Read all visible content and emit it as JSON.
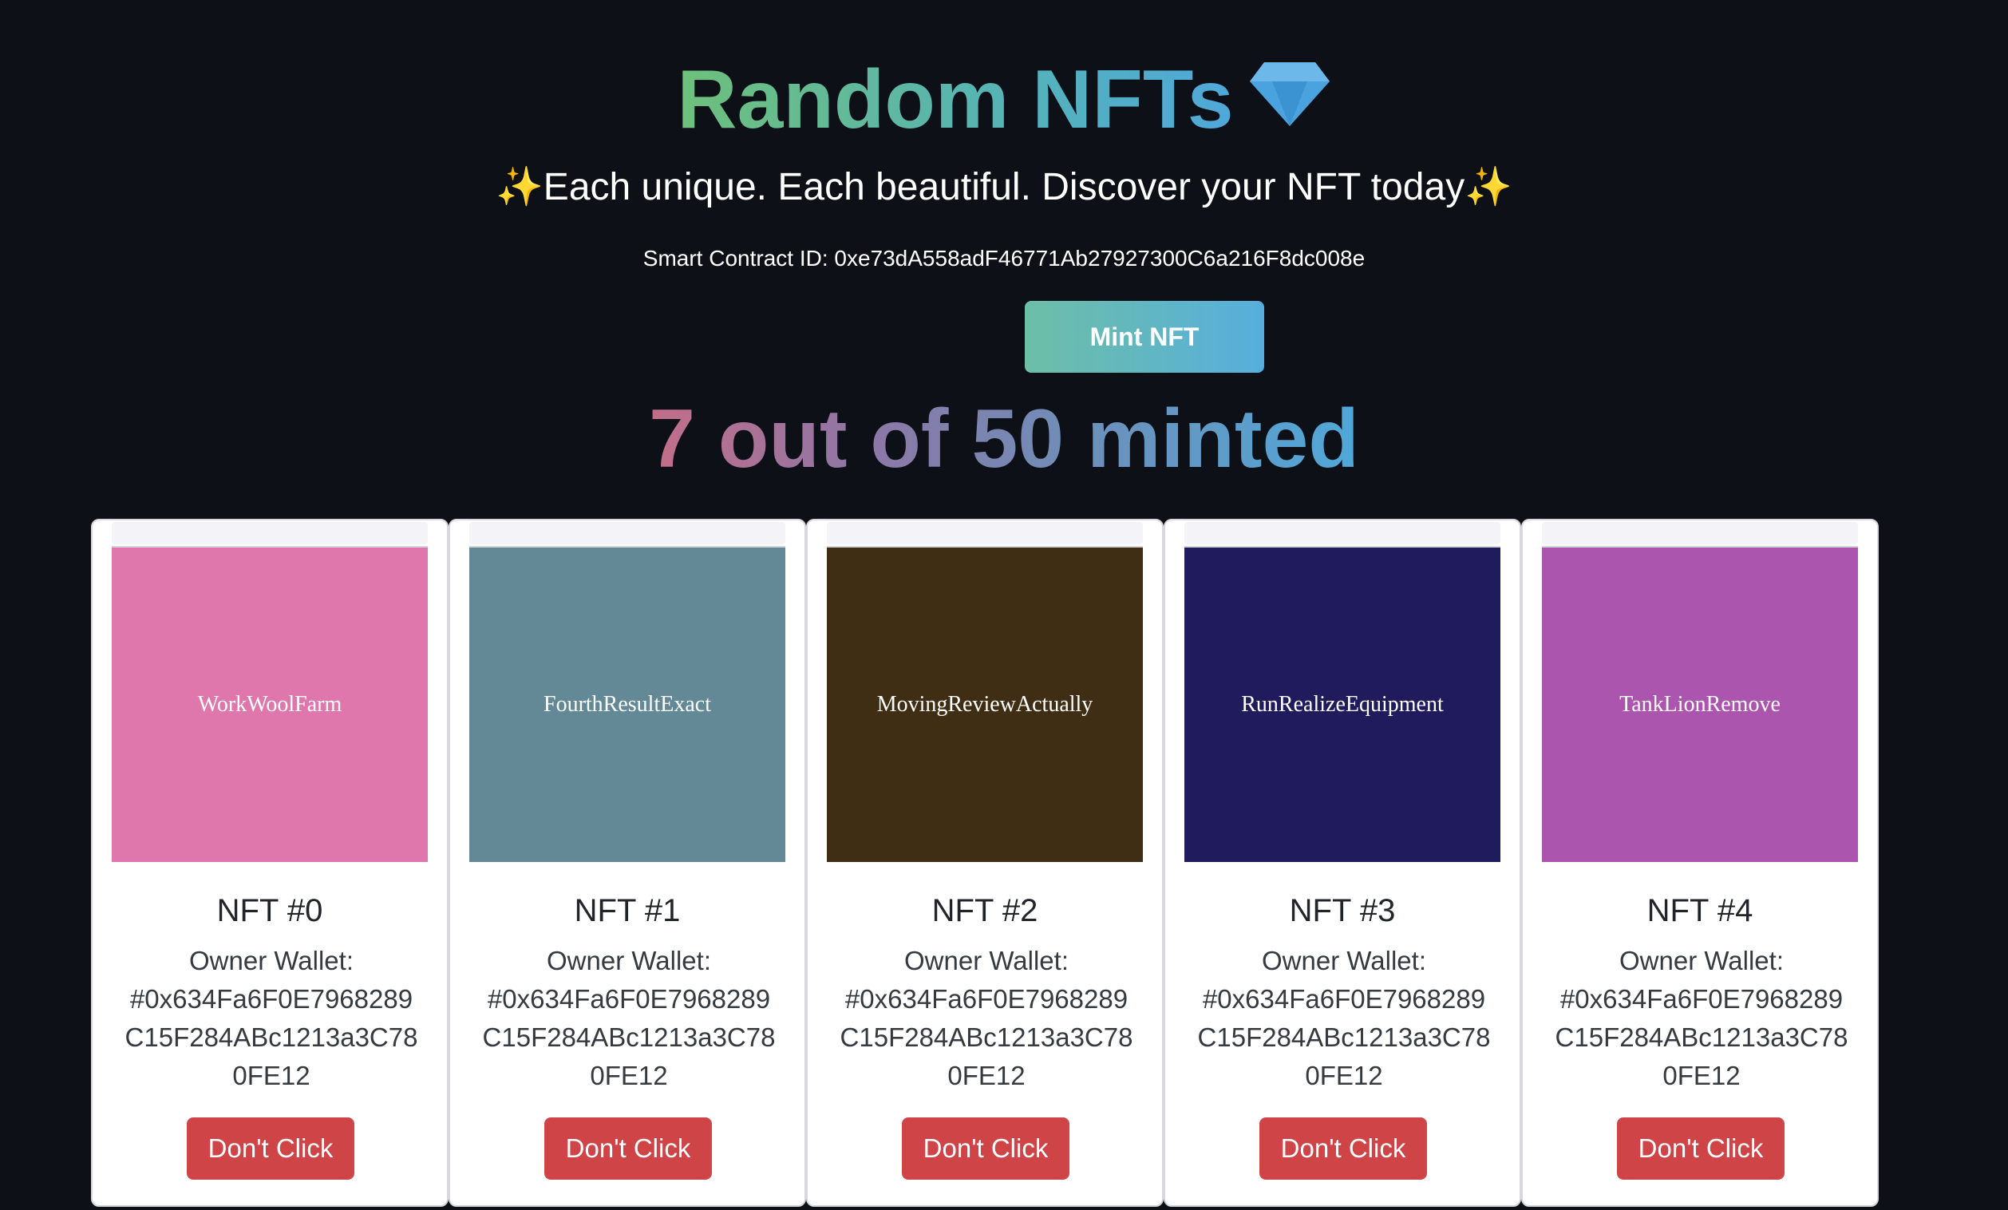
{
  "header": {
    "title": "Random NFTs",
    "title_icon": "gem-icon",
    "subtitle": "Each unique. Each beautiful. Discover your NFT today",
    "subtitle_sparkle": "✨",
    "contract_label": "Smart Contract ID: 0xe73dA558adF46771Ab27927300C6a216F8dc008e",
    "mint_button": "Mint NFT",
    "minted_status": "7 out of 50 minted"
  },
  "colors": {
    "background": "#0d1117",
    "button_danger": "#cf4447"
  },
  "cards": [
    {
      "image_text": "WorkWoolFarm",
      "image_color": "#df77ad",
      "title": "NFT #0",
      "owner_label": "Owner Wallet:",
      "owner_value": "#0x634Fa6F0E7968289C15F284ABc1213a3C780FE12",
      "button": "Don't Click"
    },
    {
      "image_text": "FourthResultExact",
      "image_color": "#638896",
      "title": "NFT #1",
      "owner_label": "Owner Wallet:",
      "owner_value": "#0x634Fa6F0E7968289C15F284ABc1213a3C780FE12",
      "button": "Don't Click"
    },
    {
      "image_text": "MovingReviewActually",
      "image_color": "#3f2e13",
      "title": "NFT #2",
      "owner_label": "Owner Wallet:",
      "owner_value": "#0x634Fa6F0E7968289C15F284ABc1213a3C780FE12",
      "button": "Don't Click"
    },
    {
      "image_text": "RunRealizeEquipment",
      "image_color": "#1f1b5d",
      "title": "NFT #3",
      "owner_label": "Owner Wallet:",
      "owner_value": "#0x634Fa6F0E7968289C15F284ABc1213a3C780FE12",
      "button": "Don't Click"
    },
    {
      "image_text": "TankLionRemove",
      "image_color": "#ab55ae",
      "title": "NFT #4",
      "owner_label": "Owner Wallet:",
      "owner_value": "#0x634Fa6F0E7968289C15F284ABc1213a3C780FE12",
      "button": "Don't Click"
    }
  ]
}
